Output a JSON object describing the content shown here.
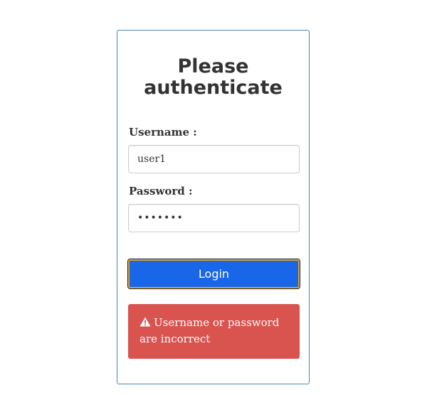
{
  "login_card": {
    "title": "Please authenticate",
    "username_label": "Username :",
    "username_value": "user1",
    "password_label": "Password :",
    "password_masked": "•••••••",
    "login_button_label": "Login"
  },
  "alert": {
    "icon": "warning-icon",
    "message": "Username or password are incorrect",
    "color": "#d9534f"
  },
  "colors": {
    "card_border": "#4a86b8",
    "button_bg": "#1a66e8",
    "button_focus_ring": "#d9a435"
  }
}
